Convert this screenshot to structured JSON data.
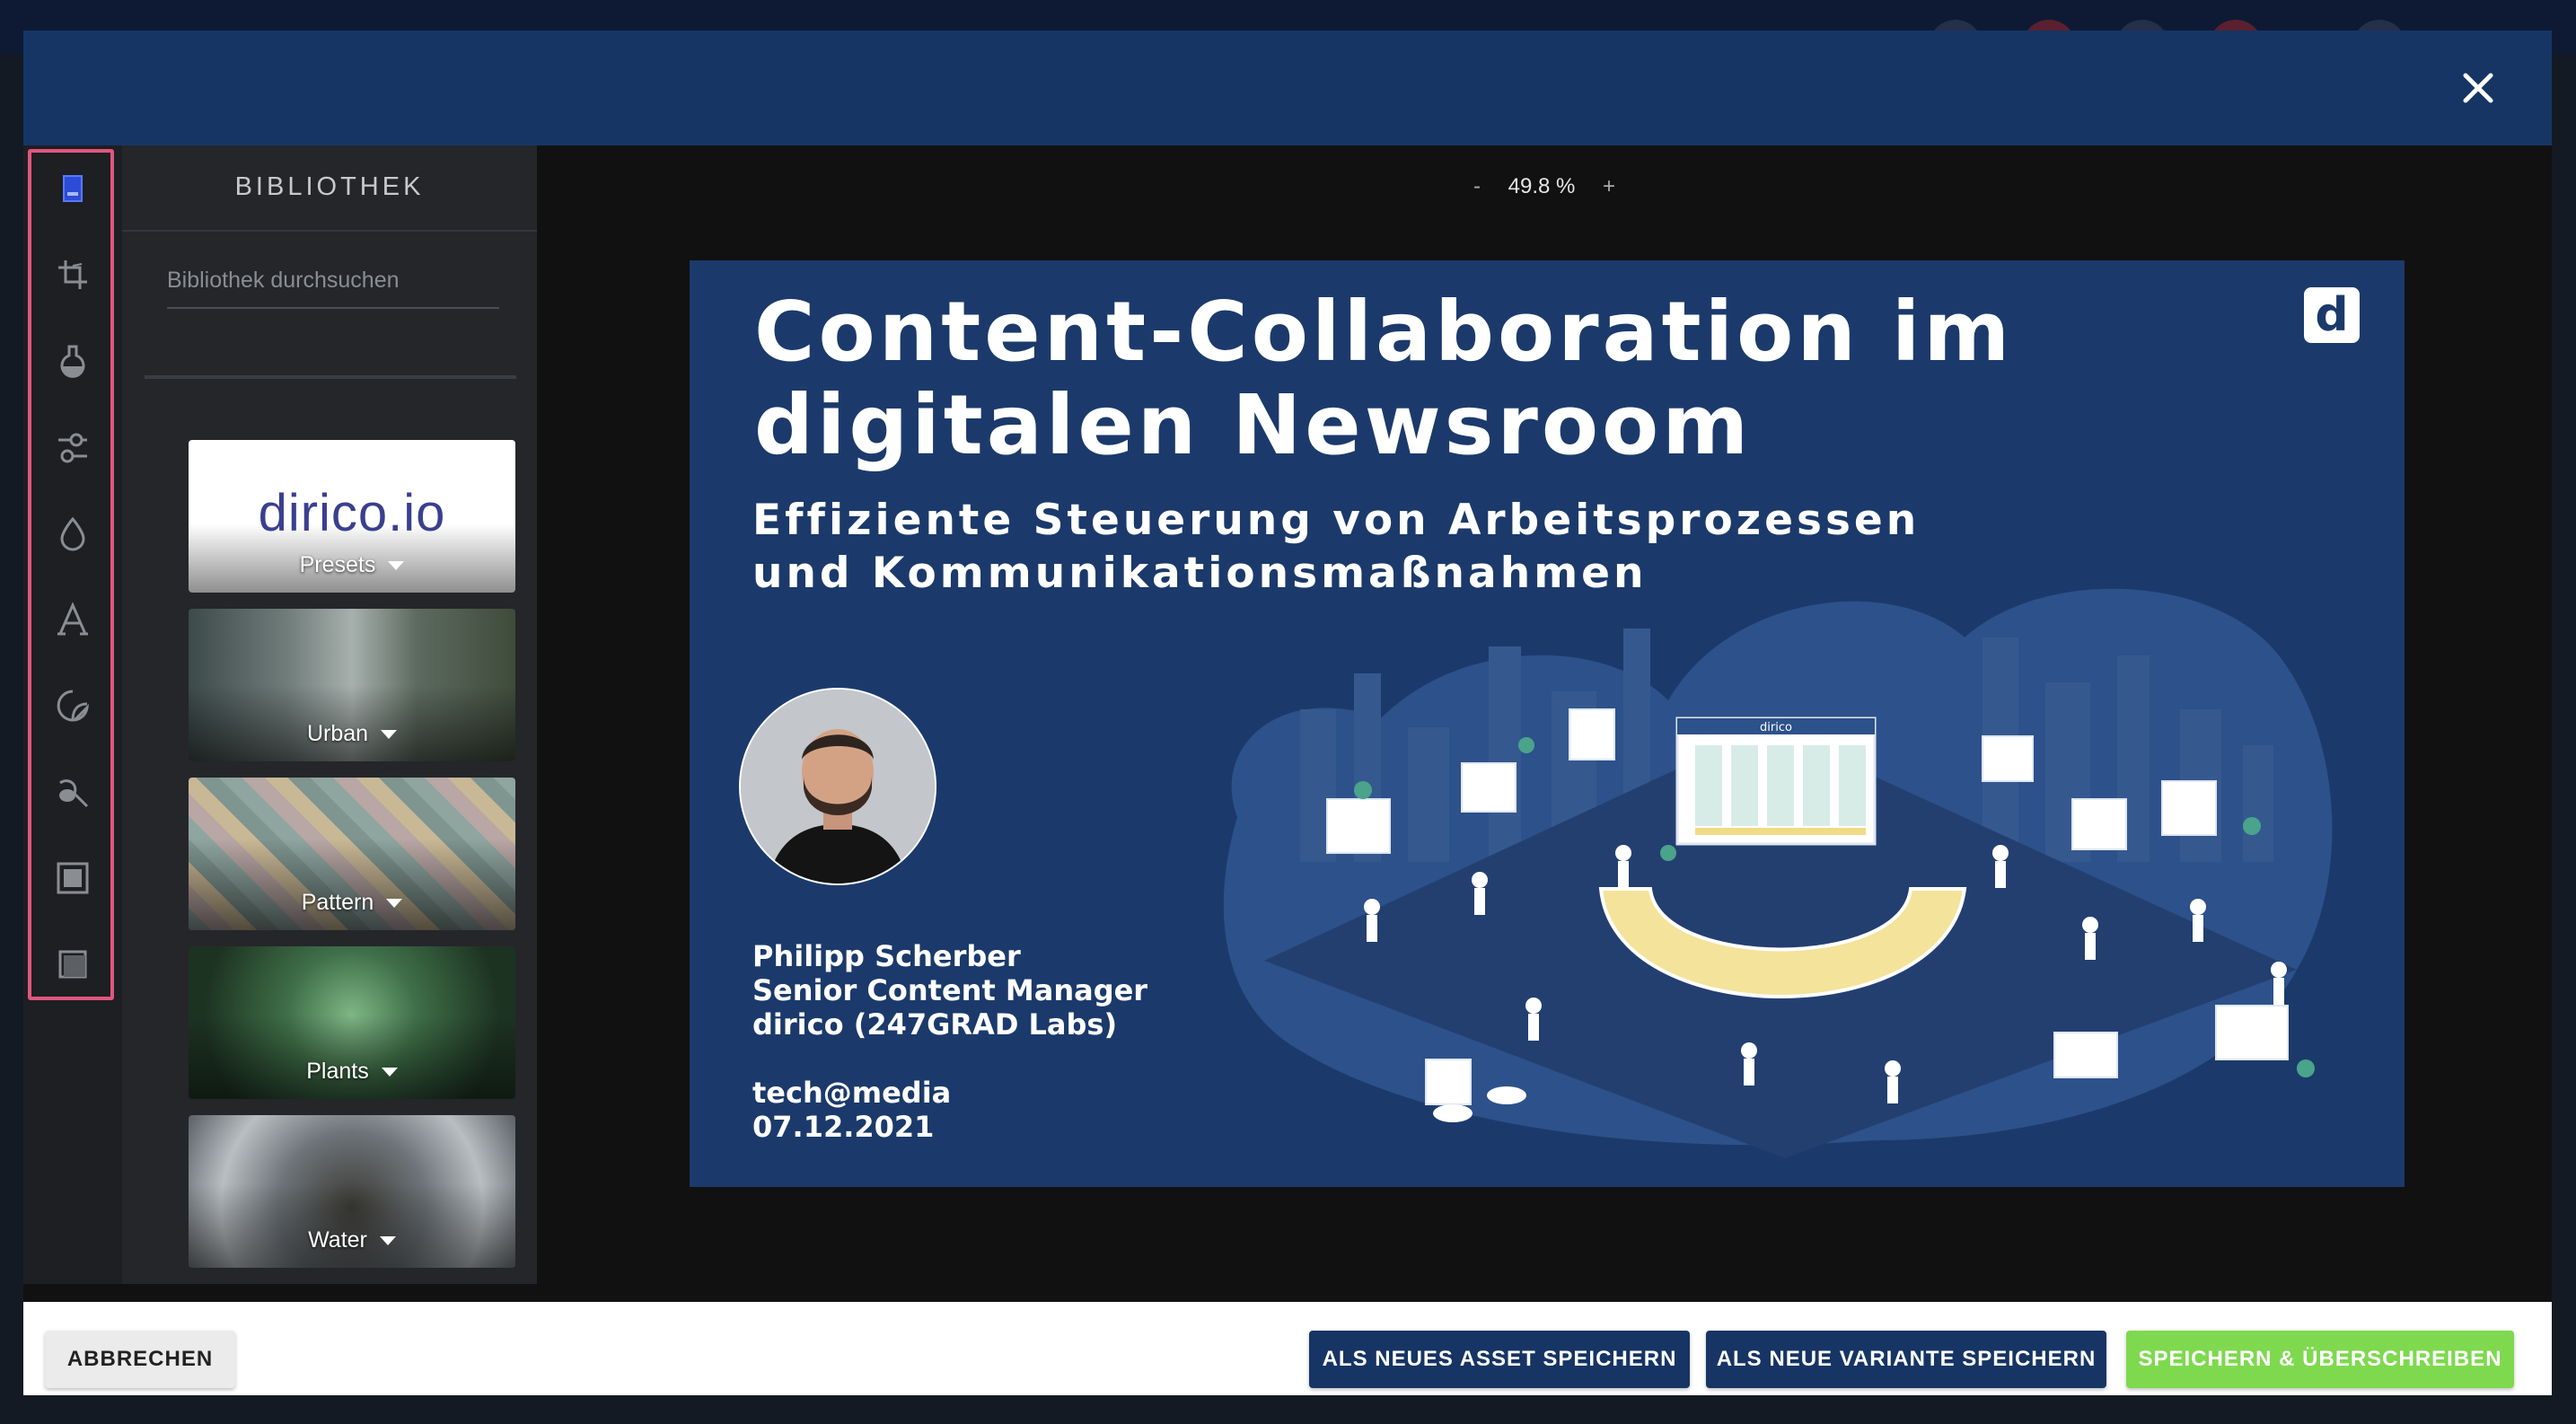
{
  "library": {
    "title": "BIBLIOTHEK",
    "search_placeholder": "Bibliothek durchsuchen",
    "items": [
      {
        "label": "Presets",
        "thumb_text": "dirico.io"
      },
      {
        "label": "Urban"
      },
      {
        "label": "Pattern"
      },
      {
        "label": "Plants"
      },
      {
        "label": "Water"
      }
    ]
  },
  "zoom": {
    "minus": "-",
    "value": "49.8 %",
    "plus": "+"
  },
  "slide": {
    "title": "Content-Collaboration im\ndigitalen Newsroom",
    "subtitle": "Effiziente Steuerung von Arbeitsprozessen\nund Kommunikationsmaßnahmen",
    "logo_letter": "d",
    "speaker_name": "Philipp Scherber",
    "speaker_role": "Senior Content Manager",
    "speaker_company": "dirico (247GRAD Labs)",
    "event": "tech@media",
    "date": "07.12.2021",
    "screen_brand": "dirico"
  },
  "tools": [
    "library-icon",
    "crop-icon",
    "filter-icon",
    "adjust-icon",
    "focus-icon",
    "text-icon",
    "sticker-icon",
    "brush-icon",
    "frame-icon",
    "overlay-icon"
  ],
  "footer": {
    "cancel": "ABBRECHEN",
    "save_new_asset": "ALS NEUES ASSET SPEICHERN",
    "save_new_variant": "ALS NEUE VARIANTE SPEICHERN",
    "save_overwrite": "SPEICHERN & ÜBERSCHREIBEN"
  },
  "colors": {
    "header": "#163564",
    "slide_bg": "#1b3a6b",
    "accent_green": "#7ed94e",
    "tool_frame": "#e0567f"
  }
}
